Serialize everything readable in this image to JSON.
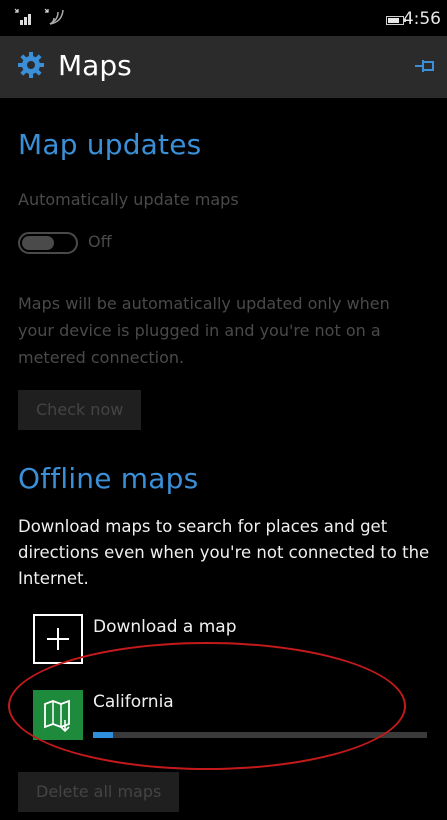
{
  "status_bar": {
    "time": "4:56"
  },
  "header": {
    "title": "Maps"
  },
  "map_updates": {
    "heading": "Map updates",
    "toggle_label": "Automatically update maps",
    "toggle_state": "Off",
    "description": "Maps will be automatically updated only when your device is plugged in and you're not on a metered connection.",
    "check_now_label": "Check now"
  },
  "offline_maps": {
    "heading": "Offline maps",
    "description": "Download maps to search for places and get directions even when you're not connected to the Internet.",
    "download_label": "Download a map",
    "downloads": [
      {
        "name": "California",
        "progress": 0.06
      }
    ],
    "delete_all_label": "Delete all maps"
  },
  "colors": {
    "accent": "#3a8fd6",
    "map_tile": "#1e8a3c",
    "annotation": "#c41a1a"
  }
}
